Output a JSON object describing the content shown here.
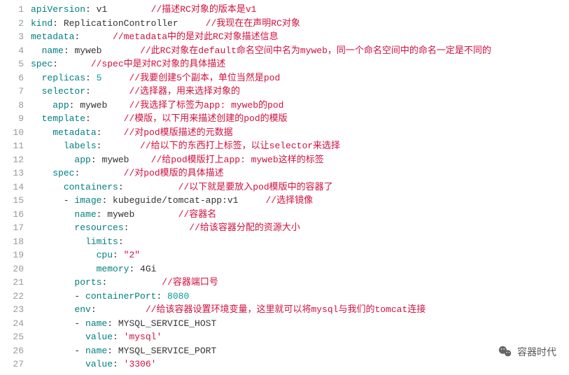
{
  "watermark": "容器时代",
  "lines": [
    {
      "n": 1,
      "tokens": [
        {
          "t": "apiVersion",
          "c": "key"
        },
        {
          "t": ": ",
          "c": "plain"
        },
        {
          "t": "v1",
          "c": "val"
        },
        {
          "t": "        ",
          "c": "plain"
        },
        {
          "t": "//描述RC对象的版本是v1",
          "c": "com"
        }
      ]
    },
    {
      "n": 2,
      "tokens": [
        {
          "t": "kind",
          "c": "key"
        },
        {
          "t": ": ",
          "c": "plain"
        },
        {
          "t": "ReplicationController",
          "c": "val"
        },
        {
          "t": "     ",
          "c": "plain"
        },
        {
          "t": "//我现在在声明RC对象",
          "c": "com"
        }
      ]
    },
    {
      "n": 3,
      "tokens": [
        {
          "t": "metadata",
          "c": "key"
        },
        {
          "t": ":      ",
          "c": "plain"
        },
        {
          "t": "//metadata中的是对此RC对象描述信息",
          "c": "com"
        }
      ]
    },
    {
      "n": 4,
      "tokens": [
        {
          "t": "  ",
          "c": "plain"
        },
        {
          "t": "name",
          "c": "key"
        },
        {
          "t": ": ",
          "c": "plain"
        },
        {
          "t": "myweb",
          "c": "val"
        },
        {
          "t": "       ",
          "c": "plain"
        },
        {
          "t": "//此RC对象在default命名空间中名为myweb，同一个命名空间中的命名一定是不同的",
          "c": "com"
        }
      ]
    },
    {
      "n": 5,
      "tokens": [
        {
          "t": "spec",
          "c": "key"
        },
        {
          "t": ":      ",
          "c": "plain"
        },
        {
          "t": "//spec中是对RC对象的具体描述",
          "c": "com"
        }
      ]
    },
    {
      "n": 6,
      "tokens": [
        {
          "t": "  ",
          "c": "plain"
        },
        {
          "t": "replicas",
          "c": "key"
        },
        {
          "t": ": ",
          "c": "plain"
        },
        {
          "t": "5",
          "c": "num"
        },
        {
          "t": "     ",
          "c": "plain"
        },
        {
          "t": "//我要创建5个副本，单位当然是pod",
          "c": "com"
        }
      ]
    },
    {
      "n": 7,
      "tokens": [
        {
          "t": "  ",
          "c": "plain"
        },
        {
          "t": "selector",
          "c": "key"
        },
        {
          "t": ":       ",
          "c": "plain"
        },
        {
          "t": "//选择器，用来选择对象的",
          "c": "com"
        }
      ]
    },
    {
      "n": 8,
      "tokens": [
        {
          "t": "    ",
          "c": "plain"
        },
        {
          "t": "app",
          "c": "key"
        },
        {
          "t": ": ",
          "c": "plain"
        },
        {
          "t": "myweb",
          "c": "val"
        },
        {
          "t": "    ",
          "c": "plain"
        },
        {
          "t": "//我选择了标签为app: myweb的pod",
          "c": "com"
        }
      ]
    },
    {
      "n": 9,
      "tokens": [
        {
          "t": "  ",
          "c": "plain"
        },
        {
          "t": "template",
          "c": "key"
        },
        {
          "t": ":      ",
          "c": "plain"
        },
        {
          "t": "//模版，以下用来描述创建的pod的模版",
          "c": "com"
        }
      ]
    },
    {
      "n": 10,
      "tokens": [
        {
          "t": "    ",
          "c": "plain"
        },
        {
          "t": "metadata",
          "c": "key"
        },
        {
          "t": ":    ",
          "c": "plain"
        },
        {
          "t": "//对pod模版描述的元数据",
          "c": "com"
        }
      ]
    },
    {
      "n": 11,
      "tokens": [
        {
          "t": "      ",
          "c": "plain"
        },
        {
          "t": "labels",
          "c": "key"
        },
        {
          "t": ":       ",
          "c": "plain"
        },
        {
          "t": "//给以下的东西打上标签，以让selector来选择",
          "c": "com"
        }
      ]
    },
    {
      "n": 12,
      "tokens": [
        {
          "t": "        ",
          "c": "plain"
        },
        {
          "t": "app",
          "c": "key"
        },
        {
          "t": ": ",
          "c": "plain"
        },
        {
          "t": "myweb",
          "c": "val"
        },
        {
          "t": "    ",
          "c": "plain"
        },
        {
          "t": "//给pod模版打上app: myweb这样的标签",
          "c": "com"
        }
      ]
    },
    {
      "n": 13,
      "tokens": [
        {
          "t": "    ",
          "c": "plain"
        },
        {
          "t": "spec",
          "c": "key"
        },
        {
          "t": ":        ",
          "c": "plain"
        },
        {
          "t": "//对pod模版的具体描述",
          "c": "com"
        }
      ]
    },
    {
      "n": 14,
      "tokens": [
        {
          "t": "      ",
          "c": "plain"
        },
        {
          "t": "containers",
          "c": "key"
        },
        {
          "t": ":          ",
          "c": "plain"
        },
        {
          "t": "//以下就是要放入pod模版中的容器了",
          "c": "com"
        }
      ]
    },
    {
      "n": 15,
      "tokens": [
        {
          "t": "      - ",
          "c": "dash"
        },
        {
          "t": "image",
          "c": "key"
        },
        {
          "t": ": ",
          "c": "plain"
        },
        {
          "t": "kubeguide/tomcat-app:v1",
          "c": "val"
        },
        {
          "t": "     ",
          "c": "plain"
        },
        {
          "t": "//选择镜像",
          "c": "com"
        }
      ]
    },
    {
      "n": 16,
      "tokens": [
        {
          "t": "        ",
          "c": "plain"
        },
        {
          "t": "name",
          "c": "key"
        },
        {
          "t": ": ",
          "c": "plain"
        },
        {
          "t": "myweb",
          "c": "val"
        },
        {
          "t": "        ",
          "c": "plain"
        },
        {
          "t": "//容器名",
          "c": "com"
        }
      ]
    },
    {
      "n": 17,
      "tokens": [
        {
          "t": "        ",
          "c": "plain"
        },
        {
          "t": "resources",
          "c": "key"
        },
        {
          "t": ":           ",
          "c": "plain"
        },
        {
          "t": "//给该容器分配的资源大小",
          "c": "com"
        }
      ]
    },
    {
      "n": 18,
      "tokens": [
        {
          "t": "          ",
          "c": "plain"
        },
        {
          "t": "limits",
          "c": "key"
        },
        {
          "t": ":",
          "c": "plain"
        }
      ]
    },
    {
      "n": 19,
      "tokens": [
        {
          "t": "            ",
          "c": "plain"
        },
        {
          "t": "cpu",
          "c": "key"
        },
        {
          "t": ": ",
          "c": "plain"
        },
        {
          "t": "\"2\"",
          "c": "str"
        }
      ]
    },
    {
      "n": 20,
      "tokens": [
        {
          "t": "            ",
          "c": "plain"
        },
        {
          "t": "memory",
          "c": "key"
        },
        {
          "t": ": ",
          "c": "plain"
        },
        {
          "t": "4Gi",
          "c": "val"
        }
      ]
    },
    {
      "n": 21,
      "tokens": [
        {
          "t": "        ",
          "c": "plain"
        },
        {
          "t": "ports",
          "c": "key"
        },
        {
          "t": ":          ",
          "c": "plain"
        },
        {
          "t": "//容器端口号",
          "c": "com"
        }
      ]
    },
    {
      "n": 22,
      "tokens": [
        {
          "t": "        - ",
          "c": "dash"
        },
        {
          "t": "containerPort",
          "c": "key"
        },
        {
          "t": ": ",
          "c": "plain"
        },
        {
          "t": "8080",
          "c": "num"
        }
      ]
    },
    {
      "n": 23,
      "tokens": [
        {
          "t": "        ",
          "c": "plain"
        },
        {
          "t": "env",
          "c": "key"
        },
        {
          "t": ":         ",
          "c": "plain"
        },
        {
          "t": "//给该容器设置环境变量，这里就可以将mysql与我们的tomcat连接",
          "c": "com"
        }
      ]
    },
    {
      "n": 24,
      "tokens": [
        {
          "t": "        - ",
          "c": "dash"
        },
        {
          "t": "name",
          "c": "key"
        },
        {
          "t": ": ",
          "c": "plain"
        },
        {
          "t": "MYSQL_SERVICE_HOST",
          "c": "val"
        }
      ]
    },
    {
      "n": 25,
      "tokens": [
        {
          "t": "          ",
          "c": "plain"
        },
        {
          "t": "value",
          "c": "key"
        },
        {
          "t": ": ",
          "c": "plain"
        },
        {
          "t": "'mysql'",
          "c": "str"
        }
      ]
    },
    {
      "n": 26,
      "tokens": [
        {
          "t": "        - ",
          "c": "dash"
        },
        {
          "t": "name",
          "c": "key"
        },
        {
          "t": ": ",
          "c": "plain"
        },
        {
          "t": "MYSQL_SERVICE_PORT",
          "c": "val"
        }
      ]
    },
    {
      "n": 27,
      "tokens": [
        {
          "t": "          ",
          "c": "plain"
        },
        {
          "t": "value",
          "c": "key"
        },
        {
          "t": ": ",
          "c": "plain"
        },
        {
          "t": "'3306'",
          "c": "str"
        }
      ]
    }
  ]
}
